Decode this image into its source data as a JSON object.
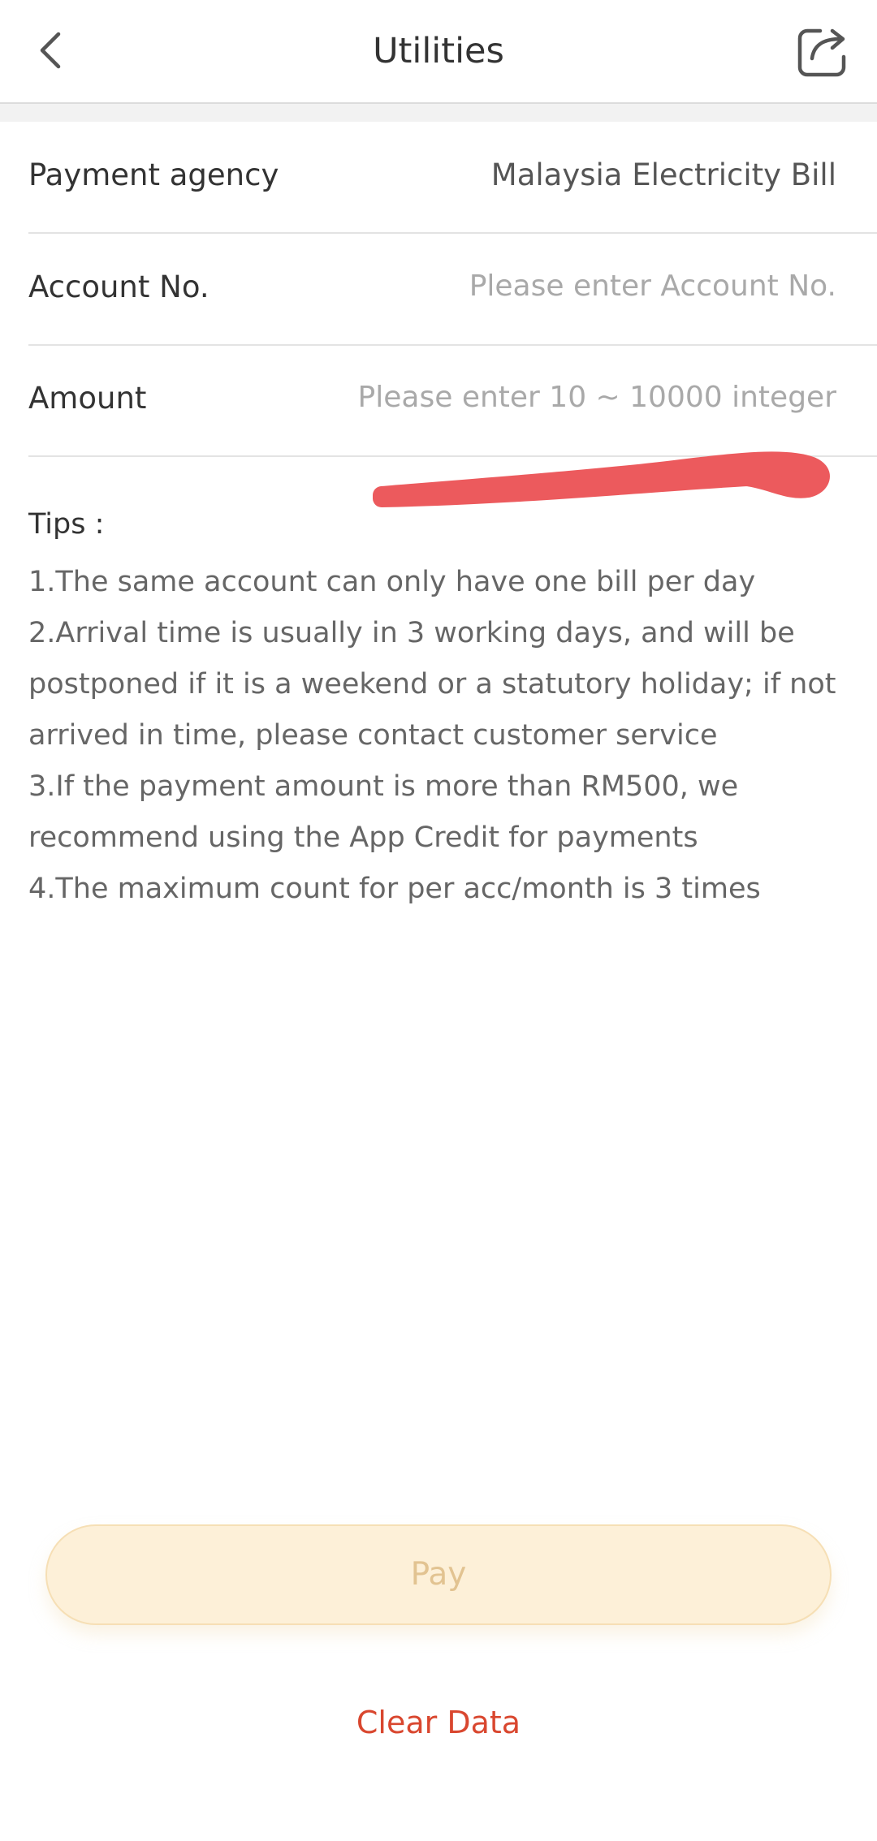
{
  "header": {
    "title": "Utilities",
    "back_icon": "chevron-left-icon",
    "share_icon": "share-icon"
  },
  "form": {
    "payment_agency": {
      "label": "Payment agency",
      "value": "Malaysia Electricity Bill"
    },
    "account_no": {
      "label": "Account No.",
      "value": "",
      "placeholder": "Please enter Account No."
    },
    "amount": {
      "label": "Amount",
      "value": "",
      "placeholder": "Please enter 10 ~ 10000 integer"
    }
  },
  "tips": {
    "title": "Tips :",
    "items": [
      "1.The same account can only have one bill per day",
      "2.Arrival time is usually in 3 working days, and will be postponed if it is a weekend or a statutory holiday; if not arrived in time, please contact customer service",
      "3.If the payment amount is more than RM500, we recommend using the App Credit for payments",
      "4.The maximum count for per acc/month is 3 times"
    ]
  },
  "actions": {
    "pay_label": "Pay",
    "clear_label": "Clear Data"
  },
  "colors": {
    "accent_red": "#d9472f",
    "scribble_red": "#ec5a5d",
    "pay_bg": "#fdf0d8",
    "pay_text": "#e2c391"
  }
}
